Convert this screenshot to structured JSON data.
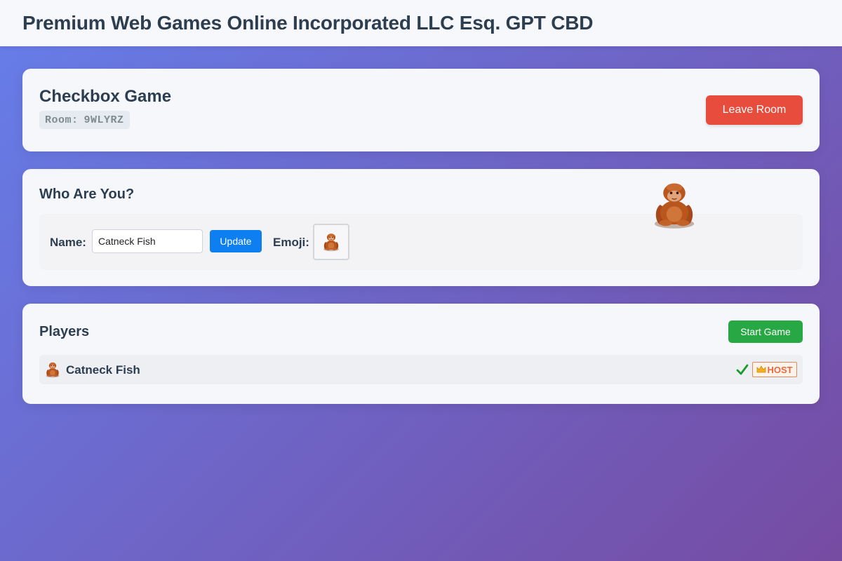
{
  "app": {
    "title": "Premium Web Games Online Incorporated LLC Esq. GPT CBD"
  },
  "room": {
    "game_title": "Checkbox Game",
    "room_label": "Room:",
    "room_code": "9WLYRZ",
    "leave_label": "Leave Room"
  },
  "identity": {
    "title": "Who Are You?",
    "name_label": "Name:",
    "name_value": "Catneck Fish",
    "update_label": "Update",
    "emoji_label": "Emoji:",
    "selected_emoji": "orangutan-icon"
  },
  "players": {
    "title": "Players",
    "start_label": "Start Game",
    "list": [
      {
        "name": "Catneck Fish",
        "emoji": "orangutan-icon",
        "ready": true,
        "badge": "HOST"
      }
    ]
  },
  "colors": {
    "primary": "#0d7ff0",
    "danger": "#e74c3c",
    "success": "#28a745",
    "host_badge": "#e8693c",
    "gradient_start": "#667eea",
    "gradient_end": "#764ba2"
  }
}
